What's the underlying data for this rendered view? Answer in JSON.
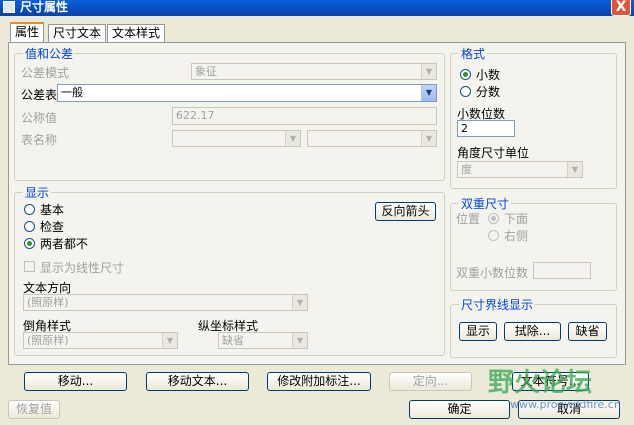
{
  "window": {
    "title": "尺寸属性",
    "close_label": "X"
  },
  "tabs": [
    {
      "label": "属性"
    },
    {
      "label": "尺寸文本"
    },
    {
      "label": "文本样式"
    }
  ],
  "value_tolerance": {
    "title": "值和公差",
    "tolerance_mode_label": "公差模式",
    "tolerance_mode_value": "象征",
    "tolerance_table_label": "公差表",
    "tolerance_table_value": "一般",
    "nominal_label": "公称值",
    "nominal_value": "622.17",
    "table_name_label": "表名称"
  },
  "format": {
    "title": "格式",
    "decimal_label": "小数",
    "fraction_label": "分数",
    "decimal_places_label": "小数位数",
    "decimal_places_value": "2",
    "angle_units_label": "角度尺寸单位",
    "angle_units_value": "度"
  },
  "display": {
    "title": "显示",
    "basic_label": "基本",
    "inspect_label": "检查",
    "neither_label": "两者都不",
    "flip_arrows_label": "反向箭头",
    "linear_label": "显示为线性尺寸",
    "text_orientation_label": "文本方向",
    "text_orientation_value": "(照原样)",
    "chamfer_style_label": "倒角样式",
    "chamfer_style_value": "(照原样)",
    "ordinate_style_label": "纵坐标样式",
    "ordinate_style_value": "缺省"
  },
  "dual": {
    "title": "双重尺寸",
    "position_label": "位置",
    "below_label": "下面",
    "right_label": "右侧",
    "dual_decimals_label": "双重小数位数"
  },
  "witness": {
    "title": "尺寸界线显示",
    "show_label": "显示",
    "erase_label": "拭除...",
    "default_label": "缺省"
  },
  "bottom_buttons": {
    "move": "移动...",
    "move_text": "移动文本...",
    "modify_attached": "修改附加标注...",
    "orient": "定向...",
    "text_symbol": "文本符号..."
  },
  "footer": {
    "restore": "恢复值",
    "ok": "确定",
    "cancel": "取消"
  },
  "watermark": {
    "text": "野火论坛",
    "url": "www.proewildfire.cn"
  }
}
